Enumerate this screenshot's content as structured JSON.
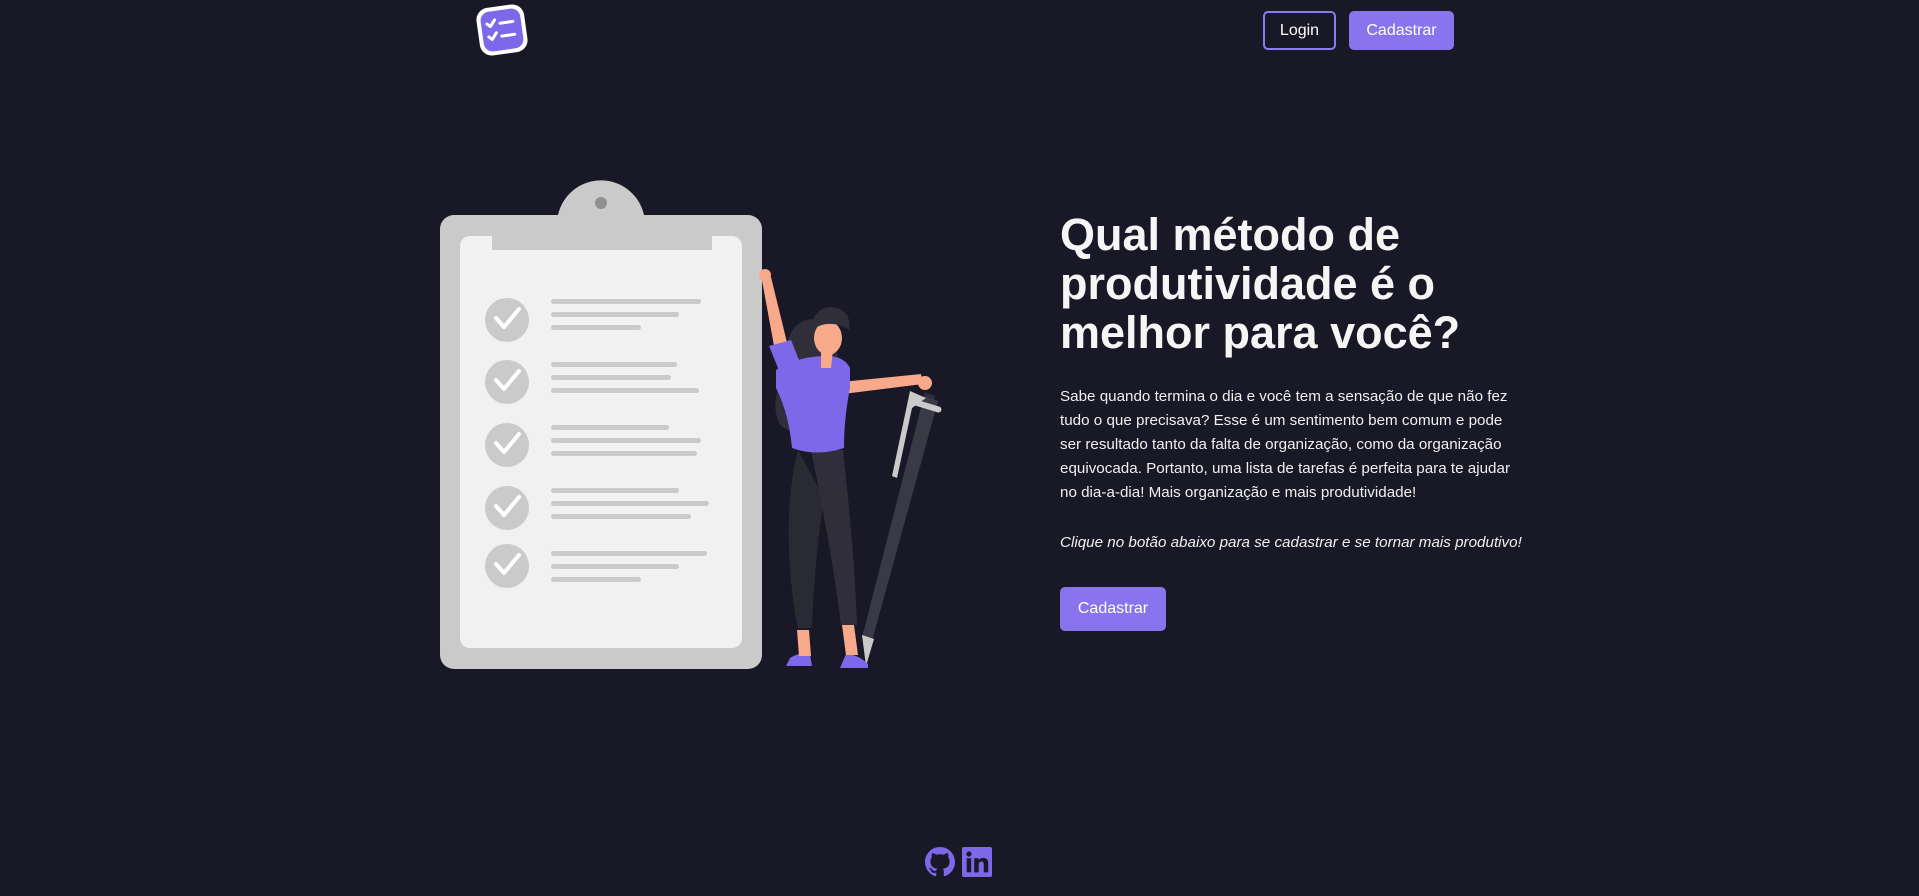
{
  "header": {
    "logo_icon": "checklist-logo-icon",
    "login_label": "Login",
    "signup_label": "Cadastrar"
  },
  "hero": {
    "title": "Qual método de produtividade é o melhor para você?",
    "description": "Sabe quando termina o dia e você tem a sensação de que não fez tudo o que precisava? Esse é um sentimento bem comum e pode ser resultado tanto da falta de organização, como da organização equivocada. Portanto, uma lista de tarefas é perfeita para te ajudar no dia-a-dia! Mais organização e mais produtividade!",
    "cta_text": "Clique no botão abaixo para se cadastrar e se tornar mais produtivo!",
    "signup_label": "Cadastrar",
    "illustration": "woman-with-checklist-clipboard-illustration"
  },
  "footer": {
    "icons": [
      "github-icon",
      "linkedin-icon"
    ]
  },
  "colors": {
    "background": "#181826",
    "accent": "#8a74ee",
    "text": "#f2f2f2",
    "clipboard": "#cacaca",
    "paper": "#f1f1f1"
  }
}
